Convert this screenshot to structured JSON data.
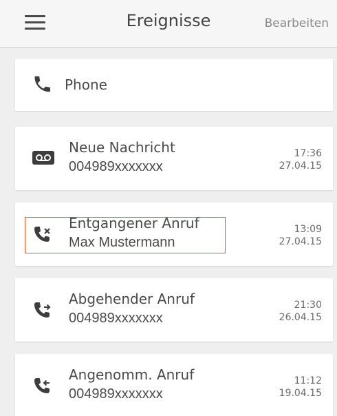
{
  "header": {
    "menu_icon": "hamburger-menu-icon",
    "title": "Ereignisse",
    "edit_label": "Bearbeiten"
  },
  "phone_card": {
    "icon": "phone-icon",
    "label": "Phone"
  },
  "events": [
    {
      "icon": "voicemail-icon",
      "title": "Neue Nachricht",
      "subtitle": "004989xxxxxxx",
      "time": "17:36",
      "date": "27.04.15"
    },
    {
      "icon": "missed-call-icon",
      "title": "Entgangener Anruf",
      "subtitle": "Max Mustermann",
      "time": "13:09",
      "date": "27.04.15"
    },
    {
      "icon": "outgoing-call-icon",
      "title": "Abgehender Anruf",
      "subtitle": "004989xxxxxxx",
      "time": "21:30",
      "date": "26.04.15"
    },
    {
      "icon": "incoming-call-icon",
      "title": "Angenomm. Anruf",
      "subtitle": "004989xxxxxxx",
      "time": "11:12",
      "date": "19.04.15"
    }
  ],
  "colors": {
    "background": "#efefef",
    "card": "#ffffff",
    "text": "#4a4a4a",
    "highlight_border": "#e25a26"
  }
}
